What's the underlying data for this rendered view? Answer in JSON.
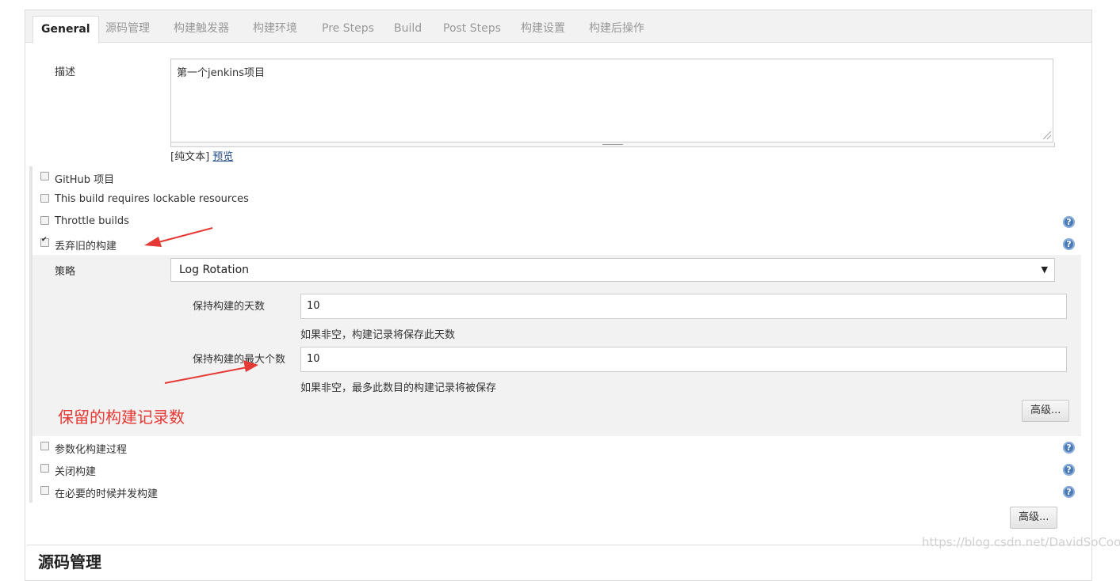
{
  "tabs": [
    {
      "label": "General",
      "active": true
    },
    {
      "label": "源码管理"
    },
    {
      "label": "构建触发器"
    },
    {
      "label": "构建环境"
    },
    {
      "label": "Pre Steps"
    },
    {
      "label": "Build"
    },
    {
      "label": "Post Steps"
    },
    {
      "label": "构建设置"
    },
    {
      "label": "构建后操作"
    }
  ],
  "description": {
    "label": "描述",
    "value": "第一个jenkins项目",
    "markup_prefix": "[纯文本]",
    "preview_link": "预览"
  },
  "options": {
    "github_project": {
      "label": "GitHub 项目",
      "checked": false
    },
    "lockable_resources": {
      "label": "This build requires lockable resources",
      "checked": false
    },
    "throttle_builds": {
      "label": "Throttle builds",
      "checked": false
    },
    "discard_old_builds": {
      "label": "丢弃旧的构建",
      "checked": true
    },
    "parameterized": {
      "label": "参数化构建过程",
      "checked": false
    },
    "disable_build": {
      "label": "关闭构建",
      "checked": false
    },
    "concurrent_builds": {
      "label": "在必要的时候并发构建",
      "checked": false
    }
  },
  "strategy": {
    "label": "策略",
    "selected": "Log Rotation",
    "days_to_keep_label": "保持构建的天数",
    "days_to_keep_value": "10",
    "days_to_keep_hint": "如果非空，构建记录将保存此天数",
    "max_builds_label": "保持构建的最大个数",
    "max_builds_value": "10",
    "max_builds_hint": "如果非空，最多此数目的构建记录将被保存",
    "advanced_button": "高级..."
  },
  "advanced_button": "高级...",
  "annotation_text": "保留的构建记录数",
  "next_section_heading": "源码管理",
  "watermark": "https://blog.csdn.net/DavidSoCool",
  "help_icon_glyph": "?",
  "colors": {
    "annotation": "#e53935",
    "help_icon": "#4a7bb7",
    "link": "#204a87"
  }
}
